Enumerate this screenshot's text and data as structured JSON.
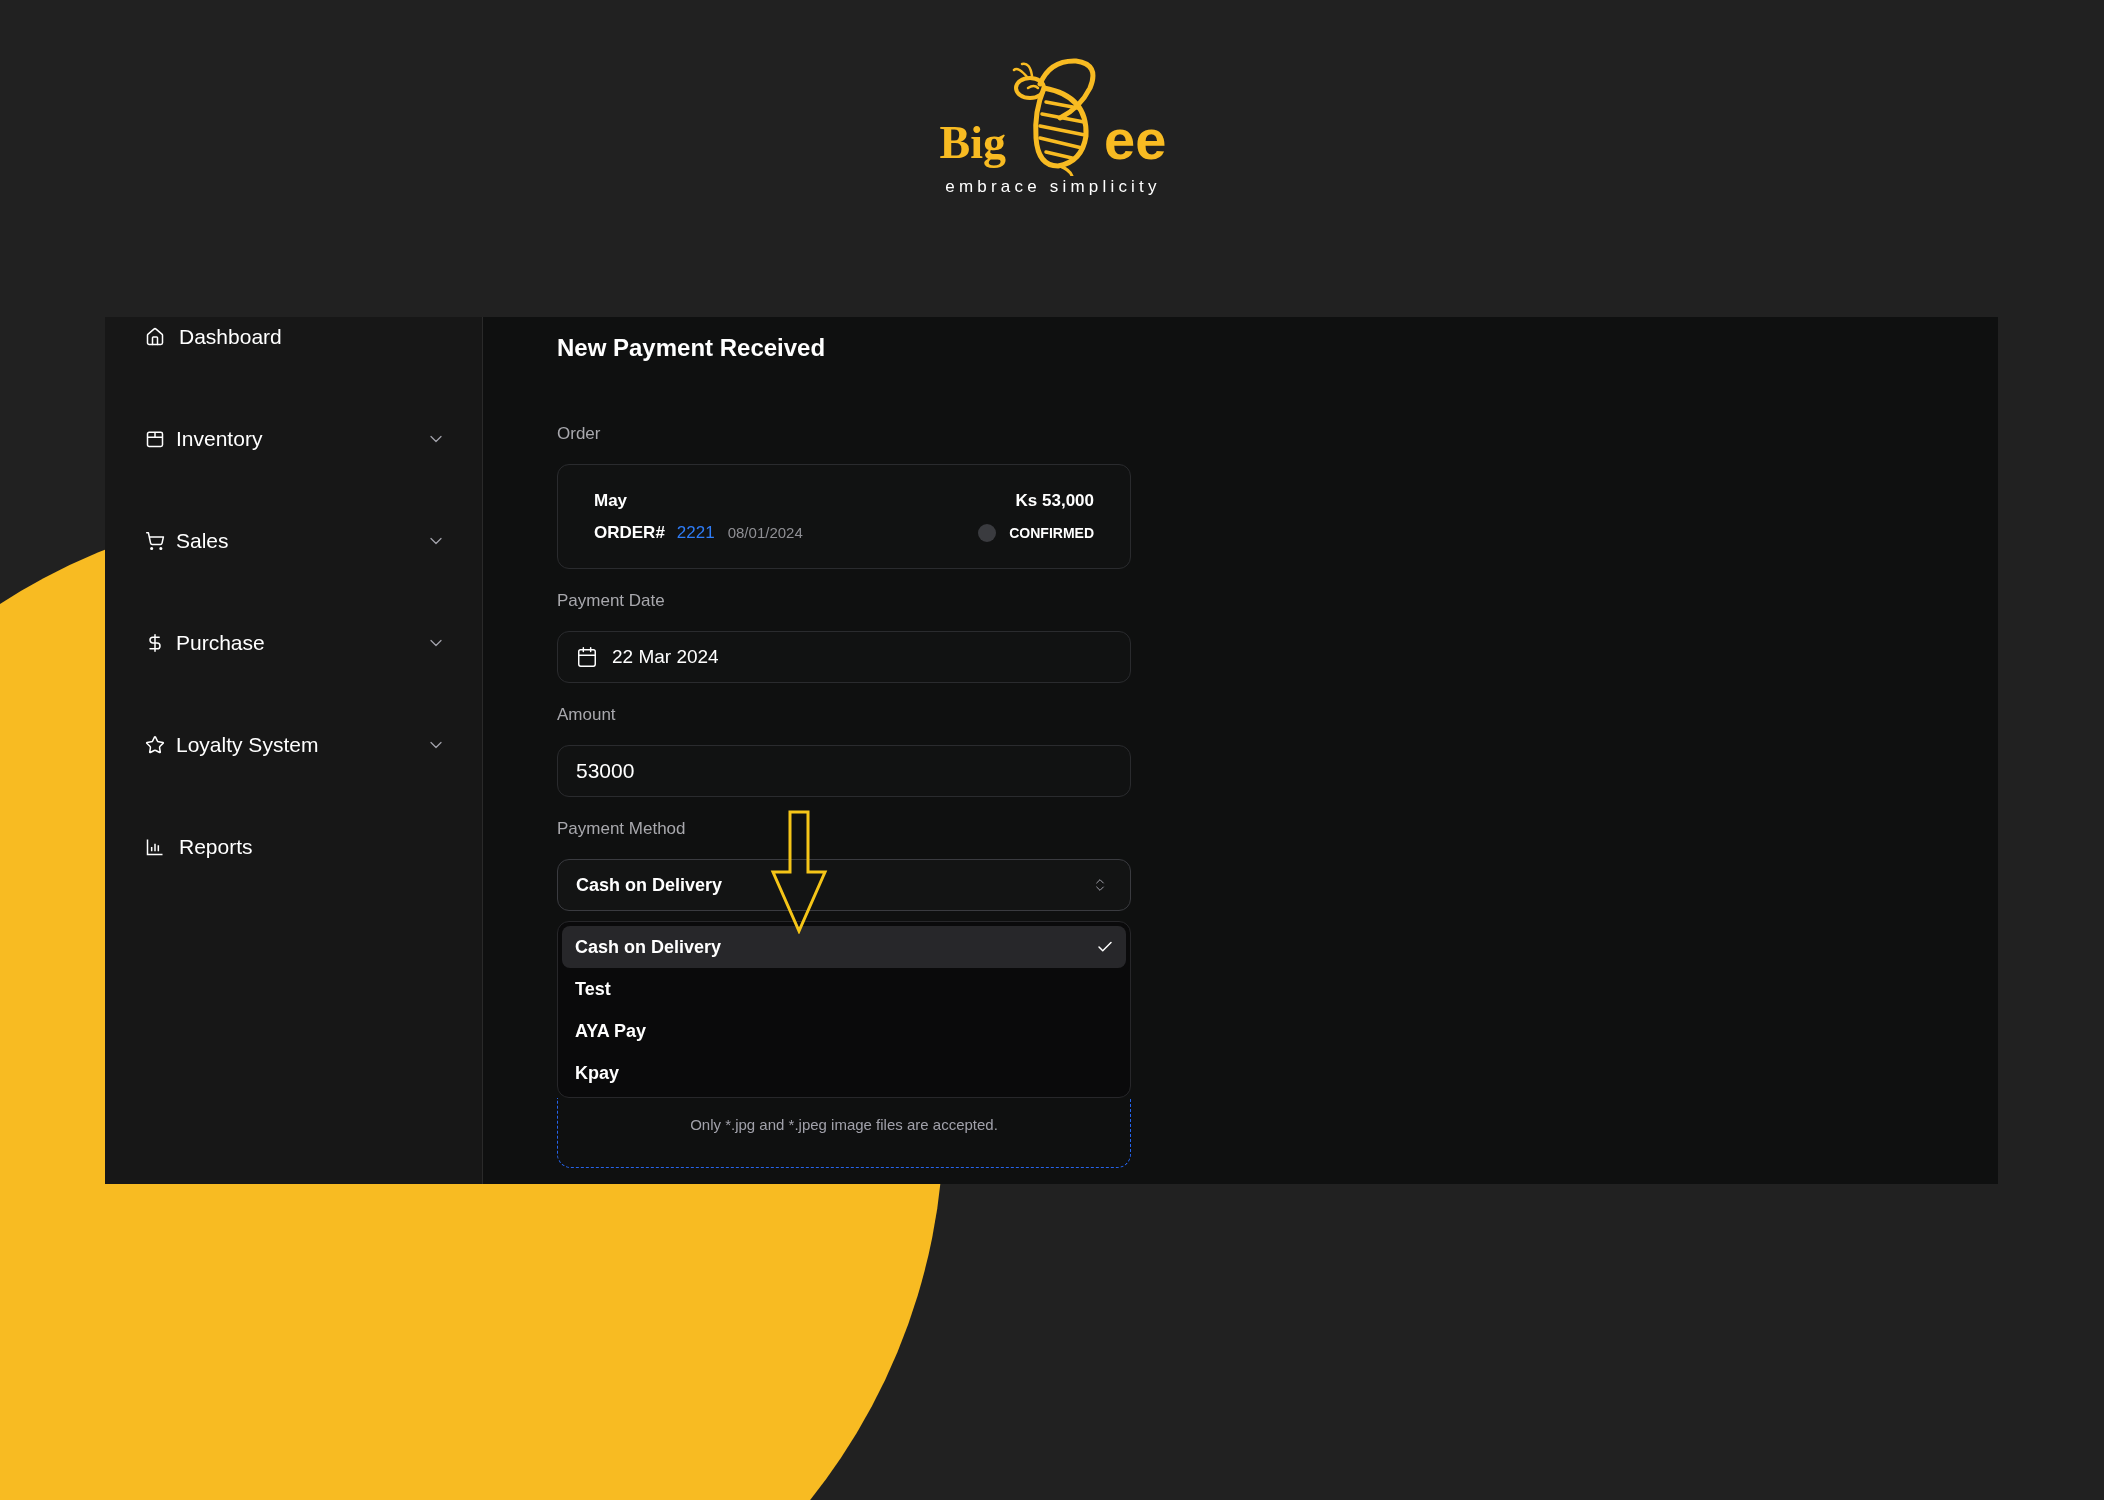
{
  "logo": {
    "word_left": "Big",
    "word_right": "ee",
    "tagline": "embrace simplicity"
  },
  "sidebar": {
    "items": [
      {
        "label": "Dashboard",
        "expandable": false
      },
      {
        "label": "Inventory",
        "expandable": true
      },
      {
        "label": "Sales",
        "expandable": true
      },
      {
        "label": "Purchase",
        "expandable": true
      },
      {
        "label": "Loyalty System",
        "expandable": true
      },
      {
        "label": "Reports",
        "expandable": false
      }
    ]
  },
  "page_title": "New Payment Received",
  "order": {
    "label": "Order",
    "customer": "May",
    "total": "Ks 53,000",
    "order_prefix": "ORDER#",
    "order_number": "2221",
    "date": "08/01/2024",
    "status": "CONFIRMED"
  },
  "payment_date": {
    "label": "Payment Date",
    "value": "22 Mar 2024"
  },
  "amount": {
    "label": "Amount",
    "value": "53000"
  },
  "payment_method": {
    "label": "Payment Method",
    "value": "Cash on Delivery",
    "expanded": true,
    "options": [
      {
        "label": "Cash on Delivery",
        "selected": true
      },
      {
        "label": "Test",
        "selected": false
      },
      {
        "label": "AYA Pay",
        "selected": false
      },
      {
        "label": "Kpay",
        "selected": false
      }
    ]
  },
  "upload": {
    "hint": "Only *.jpg and *.jpeg image files are accepted."
  }
}
